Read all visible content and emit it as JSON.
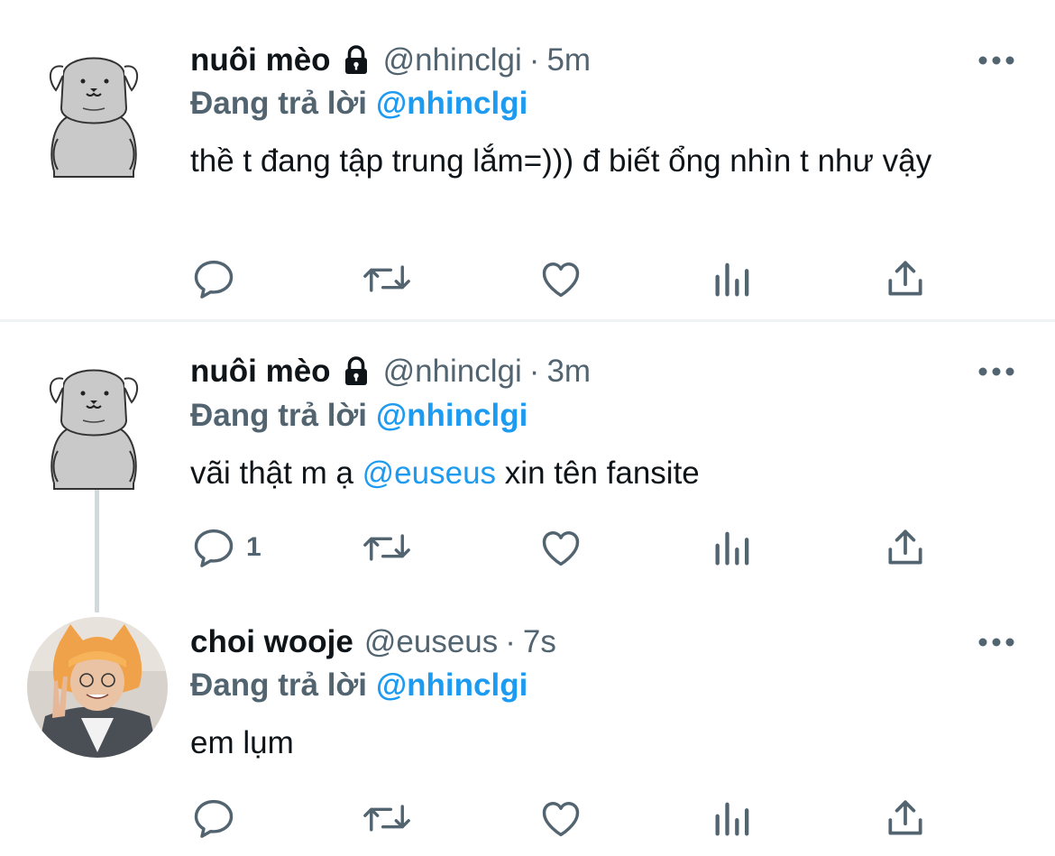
{
  "tweets": [
    {
      "name": "nuôi mèo",
      "handle": "@nhinclgi",
      "separator": "·",
      "time": "5m",
      "replying_label": "Đang trả lời",
      "replying_to": "@nhinclgi",
      "text": "thề t đang tập trung lắm=))) đ biết ổng nhìn t như vậy",
      "reply_count": ""
    },
    {
      "name": "nuôi mèo",
      "handle": "@nhinclgi",
      "separator": "·",
      "time": "3m",
      "replying_label": "Đang trả lời",
      "replying_to": "@nhinclgi",
      "text_before": "vãi thật m ạ",
      "text_mention": "@euseus",
      "text_after": "xin tên fansite",
      "reply_count": "1"
    },
    {
      "name": "choi wooje",
      "handle": "@euseus",
      "separator": "·",
      "time": "7s",
      "replying_label": "Đang trả lời",
      "replying_to": "@nhinclgi",
      "text": "em lụm",
      "reply_count": ""
    }
  ],
  "icons": {
    "lock": "lock-icon",
    "more": "more-icon",
    "reply": "reply-icon",
    "retweet": "retweet-icon",
    "like": "like-icon",
    "analytics": "analytics-icon",
    "share": "share-icon"
  },
  "colors": {
    "text": "#0f1419",
    "secondary": "#536471",
    "link": "#1d9bf0",
    "divider": "#eff3f4"
  }
}
